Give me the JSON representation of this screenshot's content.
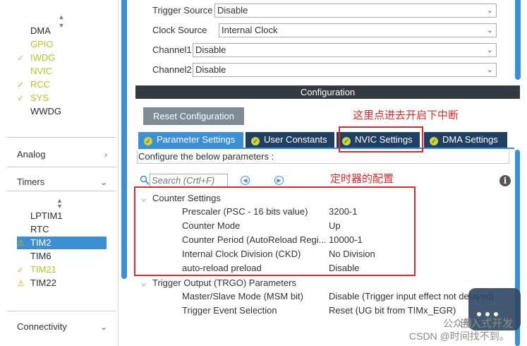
{
  "sidebar": {
    "items": [
      {
        "label": "DMA",
        "status": "none"
      },
      {
        "label": "GPIO",
        "status": "none",
        "color": "#b6c424"
      },
      {
        "label": "IWDG",
        "status": "ok"
      },
      {
        "label": "NVIC",
        "status": "none",
        "color": "#b6c424"
      },
      {
        "label": "RCC",
        "status": "ok"
      },
      {
        "label": "SYS",
        "status": "ok"
      },
      {
        "label": "WWDG",
        "status": "none"
      }
    ],
    "categories": {
      "analog": "Analog",
      "timers": "Timers",
      "connectivity": "Connectivity"
    },
    "timers": [
      {
        "label": "LPTIM1",
        "status": "none"
      },
      {
        "label": "RTC",
        "status": "none"
      },
      {
        "label": "TIM2",
        "status": "warn",
        "selected": true
      },
      {
        "label": "TIM6",
        "status": "none"
      },
      {
        "label": "TIM21",
        "status": "ok"
      },
      {
        "label": "TIM22",
        "status": "warn"
      }
    ],
    "status_icons": {
      "ok": "check-icon",
      "warn": "warning-icon"
    },
    "colors": {
      "ok": "#b6c424",
      "warn": "#e4b000",
      "selected": "#3d8fd1"
    }
  },
  "mode": {
    "trigger_source": {
      "label": "Trigger Source",
      "value": "Disable"
    },
    "clock_source": {
      "label": "Clock Source",
      "value": "Internal Clock"
    },
    "channel1": {
      "label": "Channel1",
      "value": "Disable"
    },
    "channel2": {
      "label": "Channel2",
      "value": "Disable"
    }
  },
  "config": {
    "header": "Configuration",
    "reset_button": "Reset Configuration",
    "tabs": [
      {
        "label": "Parameter Settings",
        "active": true
      },
      {
        "label": "User Constants",
        "active": false
      },
      {
        "label": "NVIC Settings",
        "active": false
      },
      {
        "label": "DMA Settings",
        "active": false
      }
    ],
    "configure_label": "Configure the below parameters :",
    "search_placeholder": "Search (Crtl+F)",
    "groups": {
      "counter": {
        "label": "Counter Settings",
        "params": [
          {
            "name": "Prescaler (PSC - 16 bits value)",
            "value": "3200-1"
          },
          {
            "name": "Counter Mode",
            "value": "Up"
          },
          {
            "name": "Counter Period (AutoReload Regi...",
            "value": "10000-1"
          },
          {
            "name": "Internal Clock Division (CKD)",
            "value": "No Division"
          },
          {
            "name": "auto-reload preload",
            "value": "Disable"
          }
        ]
      },
      "trgo": {
        "label": "Trigger Output (TRGO) Parameters",
        "params": [
          {
            "name": "Master/Slave Mode (MSM bit)",
            "value": "Disable (Trigger input effect not delayed)"
          },
          {
            "name": "Trigger Event Selection",
            "value": "Reset (UG bit from TIMx_EGR)"
          }
        ]
      }
    },
    "colors": {
      "tab_active": "#3b8fd6",
      "tab_inactive": "#1f3f63",
      "header_bg": "#333a41"
    }
  },
  "annotations": {
    "nvic_note": "这里点进去开启下中断",
    "timer_note": "定时器的配置",
    "color": "#e0282a"
  },
  "watermark": {
    "brand": "嵌入式开发",
    "source": "CSDN @时间找不到。",
    "wechat": "公众号"
  }
}
